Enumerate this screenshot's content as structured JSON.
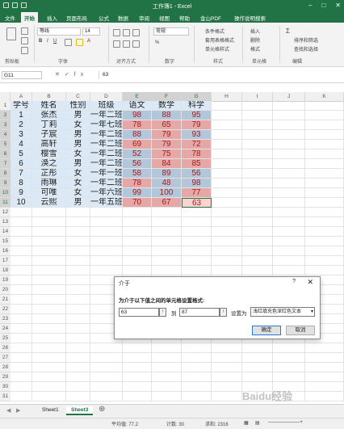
{
  "window": {
    "title": "工作簿1 - Excel"
  },
  "tabs": [
    "文件",
    "开始",
    "插入",
    "页面布局",
    "公式",
    "数据",
    "审阅",
    "视图",
    "帮助",
    "金山PDF",
    "操作说明搜索"
  ],
  "ribbon": {
    "font_name": "等线",
    "font_size": "14",
    "groups": [
      "剪贴板",
      "字体",
      "对齐方式",
      "数字",
      "样式",
      "单元格",
      "编辑"
    ],
    "number_format": "常规",
    "percent": "%",
    "style_items": [
      "条件格式",
      "套用表格格式",
      "单元格样式"
    ],
    "cells_items": [
      "插入",
      "删除",
      "格式"
    ],
    "edit_items": [
      "Σ",
      "排序和筛选",
      "查找和选择"
    ]
  },
  "formula_bar": {
    "name_box": "G11",
    "fx": "fx",
    "content": "63"
  },
  "columns": [
    "A",
    "B",
    "C",
    "D",
    "E",
    "F",
    "G",
    "H",
    "I",
    "J",
    "K"
  ],
  "rows": [
    "1",
    "2",
    "3",
    "4",
    "5",
    "6",
    "7",
    "8",
    "9",
    "10",
    "11",
    "12",
    "13",
    "14",
    "15",
    "16",
    "17",
    "18",
    "19",
    "20",
    "21",
    "22",
    "23",
    "24",
    "25",
    "26",
    "27",
    "28",
    "29",
    "30",
    "31"
  ],
  "table": {
    "headers": [
      "学号",
      "姓名",
      "性别",
      "班级",
      "语文",
      "数学",
      "科学"
    ],
    "rows": [
      [
        "1",
        "张杰",
        "男",
        "一年二班",
        "98",
        "88",
        "95"
      ],
      [
        "2",
        "丁莉",
        "女",
        "一年七班",
        "78",
        "65",
        "79"
      ],
      [
        "3",
        "子宸",
        "男",
        "一年二班",
        "88",
        "79",
        "93"
      ],
      [
        "4",
        "高轩",
        "男",
        "一年二班",
        "69",
        "79",
        "72"
      ],
      [
        "5",
        "樱雪",
        "女",
        "一年二班",
        "52",
        "75",
        "78"
      ],
      [
        "6",
        "涣之",
        "男",
        "一年二班",
        "56",
        "84",
        "85"
      ],
      [
        "7",
        "芷彤",
        "女",
        "一年一班",
        "58",
        "89",
        "56"
      ],
      [
        "8",
        "雨琳",
        "女",
        "一年二班",
        "78",
        "48",
        "98"
      ],
      [
        "9",
        "可唯",
        "女",
        "一年六班",
        "99",
        "100",
        "77"
      ],
      [
        "10",
        "云熙",
        "男",
        "一年五班",
        "70",
        "67",
        "63"
      ]
    ]
  },
  "colors": {
    "highlight_fill": "#e6a8a6",
    "highlight_text": "#9c1b1f",
    "plain_fill": "#b4c6d9",
    "selected_fill": "#fbd3cf",
    "excel_green": "#217346"
  },
  "dialog": {
    "title": "介于",
    "help": "?",
    "close": "✕",
    "instruction": "为介于以下值之间的单元格设置格式:",
    "from_value": "63",
    "to_label": "到",
    "to_value": "87",
    "setas_label": "设置为",
    "format_value": "浅红填充色深红色文本",
    "ok": "确定",
    "cancel": "取消"
  },
  "sheets": [
    "Sheet1",
    "Sheet3"
  ],
  "status": {
    "average": "平均值: 77.2",
    "count": "计数: 30",
    "sum": "求和: 2316"
  },
  "watermark": "Baidu经验"
}
